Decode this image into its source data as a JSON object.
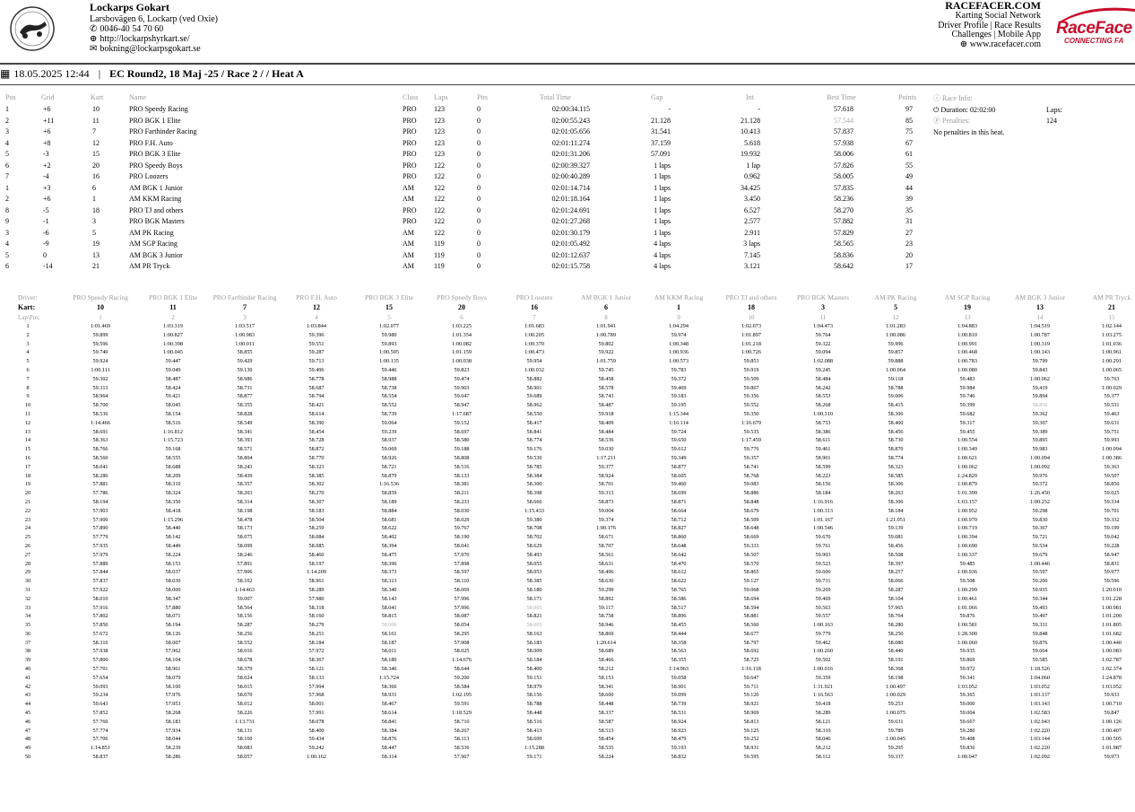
{
  "track": {
    "name": "Lockarps Gokart",
    "address": "Larsbovägen 6, Lockarp (ved Oxie)",
    "phone": "0046-40 54 70 60",
    "website": "http://lockarpshyrkart.se/",
    "email": "bokning@lockarpsgokart.se"
  },
  "racefacer": {
    "title": "RACEFACER.COM",
    "line1": "Karting Social Network",
    "line2": "Driver Profile | Race Results",
    "line3": "Challenges | Mobile App",
    "url": "www.racefacer.com",
    "logo_text": "RaceFace",
    "logo_tagline": "CONNECTING FA"
  },
  "heading": {
    "datetime": "18.05.2025 12:44",
    "separator": "|",
    "title": "EC Round2, 18 Maj -25 / Race 2 / / Heat A"
  },
  "results": {
    "columns": [
      "Pos",
      "Grid",
      "Kart",
      "Name",
      "Class",
      "Laps",
      "Pits",
      "Total Time",
      "Gap",
      "Int",
      "Best Time",
      "Points"
    ],
    "rows": [
      [
        "1",
        "+6",
        "10",
        "PRO Speedy Racing",
        "PRO",
        "123",
        "0",
        "02:00:34.115",
        "-",
        "-",
        "57.618",
        "97"
      ],
      [
        "2",
        "+11",
        "11",
        "PRO BGK 1 Elite",
        "PRO",
        "123",
        "0",
        "02:00:55.243",
        "21.128",
        "21.128",
        "57.544",
        "85"
      ],
      [
        "3",
        "+6",
        "7",
        "PRO Farthinder Racing",
        "PRO",
        "123",
        "0",
        "02:01:05.656",
        "31.541",
        "10.413",
        "57.837",
        "75"
      ],
      [
        "4",
        "+8",
        "12",
        "PRO F.H. Auto",
        "PRO",
        "123",
        "0",
        "02:01:11.274",
        "37.159",
        "5.618",
        "57.938",
        "67"
      ],
      [
        "5",
        "-3",
        "15",
        "PRO BGK 3 Elite",
        "PRO",
        "123",
        "0",
        "02:01:31.206",
        "57.091",
        "19.932",
        "58.006",
        "61"
      ],
      [
        "6",
        "+2",
        "20",
        "PRO Speedy Boys",
        "PRO",
        "122",
        "0",
        "02:00:39.327",
        "1 laps",
        "1 lap",
        "57.826",
        "55"
      ],
      [
        "7",
        "-4",
        "16",
        "PRO Loozers",
        "PRO",
        "122",
        "0",
        "02:00:40.289",
        "1 laps",
        "0.962",
        "58.005",
        "49"
      ],
      [
        "1",
        "+3",
        "6",
        "AM BGK 1 Junior",
        "AM",
        "122",
        "0",
        "02:01:14.714",
        "1 laps",
        "34.425",
        "57.835",
        "44"
      ],
      [
        "2",
        "+6",
        "1",
        "AM KKM Racing",
        "AM",
        "122",
        "0",
        "02:01:18.164",
        "1 laps",
        "3.450",
        "58.236",
        "39"
      ],
      [
        "8",
        "-5",
        "18",
        "PRO TJ and others",
        "PRO",
        "122",
        "0",
        "02:01:24.691",
        "1 laps",
        "6.527",
        "58.270",
        "35"
      ],
      [
        "9",
        "-1",
        "3",
        "PRO BGK Masters",
        "PRO",
        "122",
        "0",
        "02:01:27.268",
        "1 laps",
        "2.577",
        "57.882",
        "31"
      ],
      [
        "3",
        "-6",
        "5",
        "AM PK Racing",
        "AM",
        "122",
        "0",
        "02:01:30.179",
        "1 laps",
        "2.911",
        "57.829",
        "27"
      ],
      [
        "4",
        "-9",
        "19",
        "AM SGP Racing",
        "AM",
        "119",
        "0",
        "02:01:05.492",
        "4 laps",
        "3 laps",
        "58.565",
        "23"
      ],
      [
        "5",
        "0",
        "13",
        "AM BGK 3 Junior",
        "AM",
        "119",
        "0",
        "02:01:12.637",
        "4 laps",
        "7.145",
        "58.836",
        "20"
      ],
      [
        "6",
        "-14",
        "21",
        "AM PR Tryck",
        "AM",
        "119",
        "0",
        "02:01:15.758",
        "4 laps",
        "3.121",
        "58.642",
        "17"
      ]
    ]
  },
  "race_info": {
    "label": "Race Info:",
    "duration": "Duration: 02:02:00",
    "laps": "Laps: 124",
    "penalties_label": "Penalties:",
    "penalties_text": "No penalties in this heat."
  },
  "laptimes": {
    "driver_label": "Driver:",
    "kart_label": "Kart:",
    "lappos_label": "Lap\\Pos:",
    "drivers": [
      "PRO Speedy Racing",
      "PRO BGK 1 Elite",
      "PRO Farthinder Racing",
      "PRO F.H. Auto",
      "PRO BGK 3 Elite",
      "PRO Speedy Boys",
      "PRO Loozers",
      "AM BGK 1 Junior",
      "AM KKM Racing",
      "PRO TJ and others",
      "PRO BGK Masters",
      "AM PK Racing",
      "AM SGP Racing",
      "AM BGK 3 Junior",
      "AM PR Tryck"
    ],
    "karts": [
      "10",
      "11",
      "7",
      "12",
      "15",
      "20",
      "16",
      "6",
      "1",
      "18",
      "3",
      "5",
      "19",
      "13",
      "21"
    ],
    "positions": [
      "1",
      "2",
      "3",
      "4",
      "5",
      "6",
      "7",
      "8",
      "9",
      "10",
      "11",
      "12",
      "13",
      "14",
      "15"
    ],
    "laps": [
      [
        "1:01.469",
        "1:03.319",
        "1:03.517",
        "1:03.844",
        "1:02.077",
        "1:03.225",
        "1:01.683",
        "1:01.941",
        "1:04.294",
        "1:02.073",
        "1:04.473",
        "1:01.283",
        "1:04.883",
        "1:04.519",
        "1:02.144"
      ],
      [
        "59.899",
        "1:00.827",
        "1:00.983",
        "59.396",
        "59.980",
        "1:01.354",
        "1:00.205",
        "1:00.789",
        "59.974",
        "1:01.897",
        "59.764",
        "1:00.086",
        "1:00.810",
        "1:00.787",
        "1:03.275"
      ],
      [
        "59.596",
        "1:00.398",
        "1:00.011",
        "59.551",
        "59.893",
        "1:00.082",
        "1:00.370",
        "59.802",
        "1:00.348",
        "1:01.218",
        "59.322",
        "59.996",
        "1:00.991",
        "1:00.319",
        "1:01.036"
      ],
      [
        "59.740",
        "1:00.045",
        "58.855",
        "59.287",
        "1:00.505",
        "1:01.159",
        "1:00.473",
        "59.922",
        "1:00.936",
        "1:00.726",
        "59.094",
        "59.857",
        "1:00.468",
        "1:00.143",
        "1:00.961"
      ],
      [
        "59.924",
        "59.447",
        "59.429",
        "59.713",
        "1:00.135",
        "1:00.038",
        "59.954",
        "1:01.759",
        "1:00.573",
        "59.853",
        "1:02.088",
        "59.888",
        "1:00.783",
        "59.799",
        "1:00.291"
      ],
      [
        "1:00.111",
        "59.049",
        "59.130",
        "59.496",
        "59.446",
        "59.823",
        "1:00.032",
        "59.745",
        "59.783",
        "59.919",
        "59.245",
        "1:00.064",
        "1:00.080",
        "59.843",
        "1:00.065"
      ],
      [
        "59.302",
        "58.487",
        "58.986",
        "58.778",
        "58.988",
        "59.474",
        "58.882",
        "58.458",
        "59.372",
        "59.509",
        "58.484",
        "59.118",
        "59.483",
        "1:00.062",
        "59.763"
      ],
      [
        "59.313",
        "58.424",
        "58.731",
        "58.687",
        "58.738",
        "59.903",
        "58.901",
        "58.578",
        "59.469",
        "59.867",
        "58.242",
        "58.788",
        "59.984",
        "59.419",
        "1:00.029"
      ],
      [
        "58.964",
        "59.421",
        "58.877",
        "58.794",
        "58.554",
        "59.647",
        "59.689",
        "58.743",
        "59.183",
        "59.356",
        "58.553",
        "59.006",
        "59.746",
        "59.894",
        "59.377"
      ],
      [
        "58.700",
        "58.045",
        "58.355",
        "58.421",
        "58.552",
        "58.947",
        "58.962",
        "58.487",
        "59.195",
        "59.552",
        "58.268",
        "58.415",
        "59.399",
        "58.856",
        "59.531"
      ],
      [
        "58.536",
        "58.154",
        "58.828",
        "58.614",
        "58.739",
        "1:17.687",
        "58.550",
        "59.918",
        "1:15.344",
        "59.350",
        "1:00.310",
        "58.306",
        "59.682",
        "59.362",
        "59.463"
      ],
      [
        "1:14.466",
        "58.516",
        "58.549",
        "58.390",
        "59.064",
        "59.152",
        "58.417",
        "58.409",
        "1:16.114",
        "1:16.679",
        "58.753",
        "58.400",
        "59.317",
        "59.307",
        "59.631"
      ],
      [
        "58.691",
        "1:16.812",
        "58.341",
        "58.454",
        "59.239",
        "58.697",
        "58.841",
        "58.484",
        "59.724",
        "59.535",
        "58.386",
        "58.456",
        "59.455",
        "59.389",
        "59.751"
      ],
      [
        "58.363",
        "1:15.723",
        "58.393",
        "58.728",
        "58.937",
        "58.580",
        "58.774",
        "58.536",
        "59.650",
        "1:17.459",
        "58.611",
        "58.730",
        "1:00.554",
        "59.895",
        "59.993"
      ],
      [
        "58.766",
        "59.168",
        "58.571",
        "58.872",
        "59.069",
        "59.188",
        "59.176",
        "59.030",
        "59.612",
        "59.776",
        "59.461",
        "58.870",
        "1:00.349",
        "59.983",
        "1:00.094"
      ],
      [
        "58.560",
        "58.555",
        "58.804",
        "58.770",
        "58.926",
        "58.808",
        "59.530",
        "1:17.211",
        "59.349",
        "59.357",
        "58.901",
        "58.774",
        "1:00.621",
        "1:00.094",
        "1:00.386"
      ],
      [
        "58.041",
        "58.688",
        "58.243",
        "58.323",
        "58.721",
        "58.516",
        "58.785",
        "59.377",
        "58.877",
        "58.741",
        "58.599",
        "58.323",
        "1:00.062",
        "1:00.092",
        "59.363"
      ],
      [
        "58.286",
        "58.209",
        "58.439",
        "58.385",
        "58.879",
        "58.133",
        "58.384",
        "58.924",
        "58.605",
        "58.768",
        "58.223",
        "58.585",
        "1:24.829",
        "59.976",
        "59.507"
      ],
      [
        "57.881",
        "58.310",
        "58.357",
        "58.302",
        "1:16.536",
        "58.381",
        "58.300",
        "58.701",
        "59.460",
        "59.083",
        "58.156",
        "58.306",
        "1:00.879",
        "59.372",
        "58.850"
      ],
      [
        "57.786",
        "58.324",
        "58.203",
        "58.270",
        "58.859",
        "58.211",
        "58.398",
        "59.313",
        "58.699",
        "58.886",
        "58.184",
        "58.263",
        "1:01.399",
        "1:26.450",
        "59.025"
      ],
      [
        "58.194",
        "58.350",
        "58.314",
        "58.307",
        "58.189",
        "58.233",
        "58.666",
        "58.873",
        "58.871",
        "58.848",
        "1:16.916",
        "58.306",
        "1:03.157",
        "1:00.252",
        "59.334"
      ],
      [
        "57.903",
        "58.418",
        "58.198",
        "58.183",
        "58.884",
        "58.030",
        "1:15.433",
        "59.004",
        "58.664",
        "58.679",
        "1:00.313",
        "58.184",
        "1:00.952",
        "59.298",
        "59.701"
      ],
      [
        "57.900",
        "1:15.296",
        "58.478",
        "58.504",
        "58.681",
        "58.029",
        "59.380",
        "59.374",
        "58.712",
        "58.509",
        "1:01.167",
        "1:21.051",
        "1:00.970",
        "59.830",
        "59.332"
      ],
      [
        "57.890",
        "58.440",
        "58.173",
        "58.259",
        "58.622",
        "59.767",
        "58.708",
        "1:00.176",
        "58.827",
        "58.648",
        "1:00.546",
        "59.139",
        "1:00.719",
        "59.367",
        "59.199"
      ],
      [
        "57.779",
        "58.142",
        "58.075",
        "58.084",
        "58.402",
        "58.190",
        "58.702",
        "58.671",
        "58.860",
        "58.669",
        "59.670",
        "59.081",
        "1:00.394",
        "59.721",
        "59.042"
      ],
      [
        "57.935",
        "58.449",
        "58.099",
        "58.085",
        "58.394",
        "58.041",
        "58.629",
        "58.707",
        "58.648",
        "59.333",
        "59.761",
        "58.456",
        "1:00.690",
        "59.534",
        "59.228"
      ],
      [
        "57.979",
        "58.224",
        "58.246",
        "58.460",
        "58.475",
        "57.970",
        "58.493",
        "58.561",
        "58.642",
        "58.507",
        "59.903",
        "58.508",
        "1:00.337",
        "59.679",
        "58.947"
      ],
      [
        "57.889",
        "58.153",
        "57.891",
        "58.197",
        "58.396",
        "57.898",
        "58.055",
        "58.631",
        "58.470",
        "58.570",
        "59.523",
        "58.397",
        "59.485",
        "1:00.446",
        "58.831"
      ],
      [
        "57.844",
        "58.037",
        "57.906",
        "1:14.209",
        "58.373",
        "58.597",
        "58.053",
        "58.496",
        "58.612",
        "58.865",
        "59.606",
        "58.257",
        "1:00.936",
        "59.597",
        "59.977"
      ],
      [
        "57.837",
        "58.030",
        "58.102",
        "58.961",
        "58.313",
        "58.110",
        "58.385",
        "58.630",
        "58.622",
        "59.127",
        "59.731",
        "58.066",
        "59.508",
        "59.200",
        "59.596"
      ],
      [
        "57.922",
        "58.000",
        "1:14.463",
        "58.289",
        "58.340",
        "58.069",
        "58.180",
        "59.299",
        "58.765",
        "59.068",
        "59.269",
        "58.287",
        "1:00.299",
        "59.935",
        "1:20.010"
      ],
      [
        "58.010",
        "58.347",
        "59.007",
        "57.980",
        "58.143",
        "57.996",
        "58.171",
        "58.892",
        "58.586",
        "58.694",
        "59.469",
        "58.104",
        "1:00.461",
        "59.344",
        "1:01.228"
      ],
      [
        "57.916",
        "57.880",
        "58.564",
        "58.318",
        "58.041",
        "57.996",
        "58.005",
        "59.117",
        "58.517",
        "58.594",
        "59.563",
        "57.965",
        "1:01.066",
        "59.493",
        "1:00.981"
      ],
      [
        "57.802",
        "58.071",
        "58.156",
        "58.160",
        "58.815",
        "58.087",
        "58.821",
        "58.758",
        "58.896",
        "58.881",
        "59.557",
        "58.764",
        "59.876",
        "59.497",
        "1:01.200"
      ],
      [
        "57.850",
        "58.194",
        "58.287",
        "58.279",
        "58.006",
        "58.054",
        "58.005",
        "58.946",
        "58.455",
        "58.560",
        "1:00.163",
        "58.280",
        "1:00.581",
        "59.331",
        "1:01.805"
      ],
      [
        "57.672",
        "58.126",
        "58.256",
        "58.251",
        "58.161",
        "58.295",
        "58.163",
        "58.869",
        "58.444",
        "58.677",
        "59.779",
        "58.250",
        "1:28.300",
        "59.848",
        "1:01.682"
      ],
      [
        "58.316",
        "58.007",
        "58.552",
        "58.184",
        "58.187",
        "57.908",
        "58.183",
        "1:20.614",
        "58.358",
        "58.797",
        "59.462",
        "58.080",
        "1:00.060",
        "59.876",
        "1:00.440"
      ],
      [
        "57.938",
        "57.962",
        "58.016",
        "57.972",
        "58.011",
        "58.025",
        "58.009",
        "58.689",
        "58.563",
        "58.692",
        "1:00.260",
        "58.440",
        "59.935",
        "59.664",
        "1:00.083"
      ],
      [
        "57.800",
        "58.104",
        "58.678",
        "58.367",
        "58.180",
        "1:14.676",
        "58.184",
        "58.466",
        "58.355",
        "58.725",
        "59.502",
        "58.191",
        "59.869",
        "59.585",
        "1:02.787"
      ],
      [
        "57.701",
        "58.961",
        "58.379",
        "58.121",
        "58.346",
        "58.644",
        "58.400",
        "58.212",
        "1:14.963",
        "1:16.118",
        "1:00.016",
        "58.368",
        "59.972",
        "1:18.526",
        "1:02.374"
      ],
      [
        "57.654",
        "58.079",
        "58.024",
        "58.133",
        "1:15.724",
        "59.200",
        "59.151",
        "58.153",
        "59.058",
        "59.647",
        "59.359",
        "58.198",
        "59.341",
        "1:04.060",
        "1:24.878"
      ],
      [
        "59.093",
        "58.100",
        "58.015",
        "57.994",
        "58.366",
        "58.584",
        "58.979",
        "58.341",
        "58.901",
        "59.711",
        "1:31.921",
        "1:00.497",
        "1:03.052",
        "1:03.052",
        "1:03.052"
      ],
      [
        "59.234",
        "57.976",
        "58.070",
        "57.968",
        "58.931",
        "1:02.195",
        "58.156",
        "58.600",
        "59.099",
        "59.120",
        "1:16.563",
        "1:00.029",
        "59.365",
        "1:03.137",
        "59.933"
      ],
      [
        "59.643",
        "57.953",
        "58.012",
        "58.001",
        "58.467",
        "59.591",
        "58.788",
        "58.448",
        "58.739",
        "58.921",
        "59.418",
        "59.253",
        "59.000",
        "1:03.143",
        "1:00.710"
      ],
      [
        "57.852",
        "58.268",
        "58.226",
        "57.991",
        "58.614",
        "1:18.529",
        "58.448",
        "58.337",
        "58.531",
        "58.969",
        "58.289",
        "1:00.075",
        "59.004",
        "1:02.583",
        "59.847"
      ],
      [
        "57.760",
        "58.183",
        "1:13.731",
        "58.078",
        "58.841",
        "58.710",
        "58.516",
        "58.587",
        "58.924",
        "58.813",
        "58.121",
        "59.631",
        "59.667",
        "1:02.043",
        "1:00.126"
      ],
      [
        "57.774",
        "57.934",
        "58.131",
        "58.400",
        "58.384",
        "58.267",
        "58.413",
        "58.513",
        "58.923",
        "59.125",
        "58.310",
        "59.789",
        "59.280",
        "1:02.220",
        "1:00.407"
      ],
      [
        "57.706",
        "58.044",
        "58.160",
        "59.434",
        "58.876",
        "58.113",
        "58.609",
        "58.454",
        "58.479",
        "59.252",
        "58.046",
        "1:00.045",
        "59.408",
        "1:03.144",
        "1:00.505"
      ],
      [
        "1:14.851",
        "58.239",
        "58.083",
        "59.242",
        "58.447",
        "58.536",
        "1:15.288",
        "58.535",
        "59.193",
        "58.931",
        "58.212",
        "59.295",
        "59.836",
        "1:02.220",
        "1:01.987"
      ],
      [
        "58.837",
        "58.286",
        "58.057",
        "1:00.162",
        "58.314",
        "57.967",
        "59.171",
        "58.224",
        "58.832",
        "59.595",
        "58.112",
        "59.337",
        "1:00.047",
        "1:02.092",
        "59.973"
      ]
    ]
  }
}
